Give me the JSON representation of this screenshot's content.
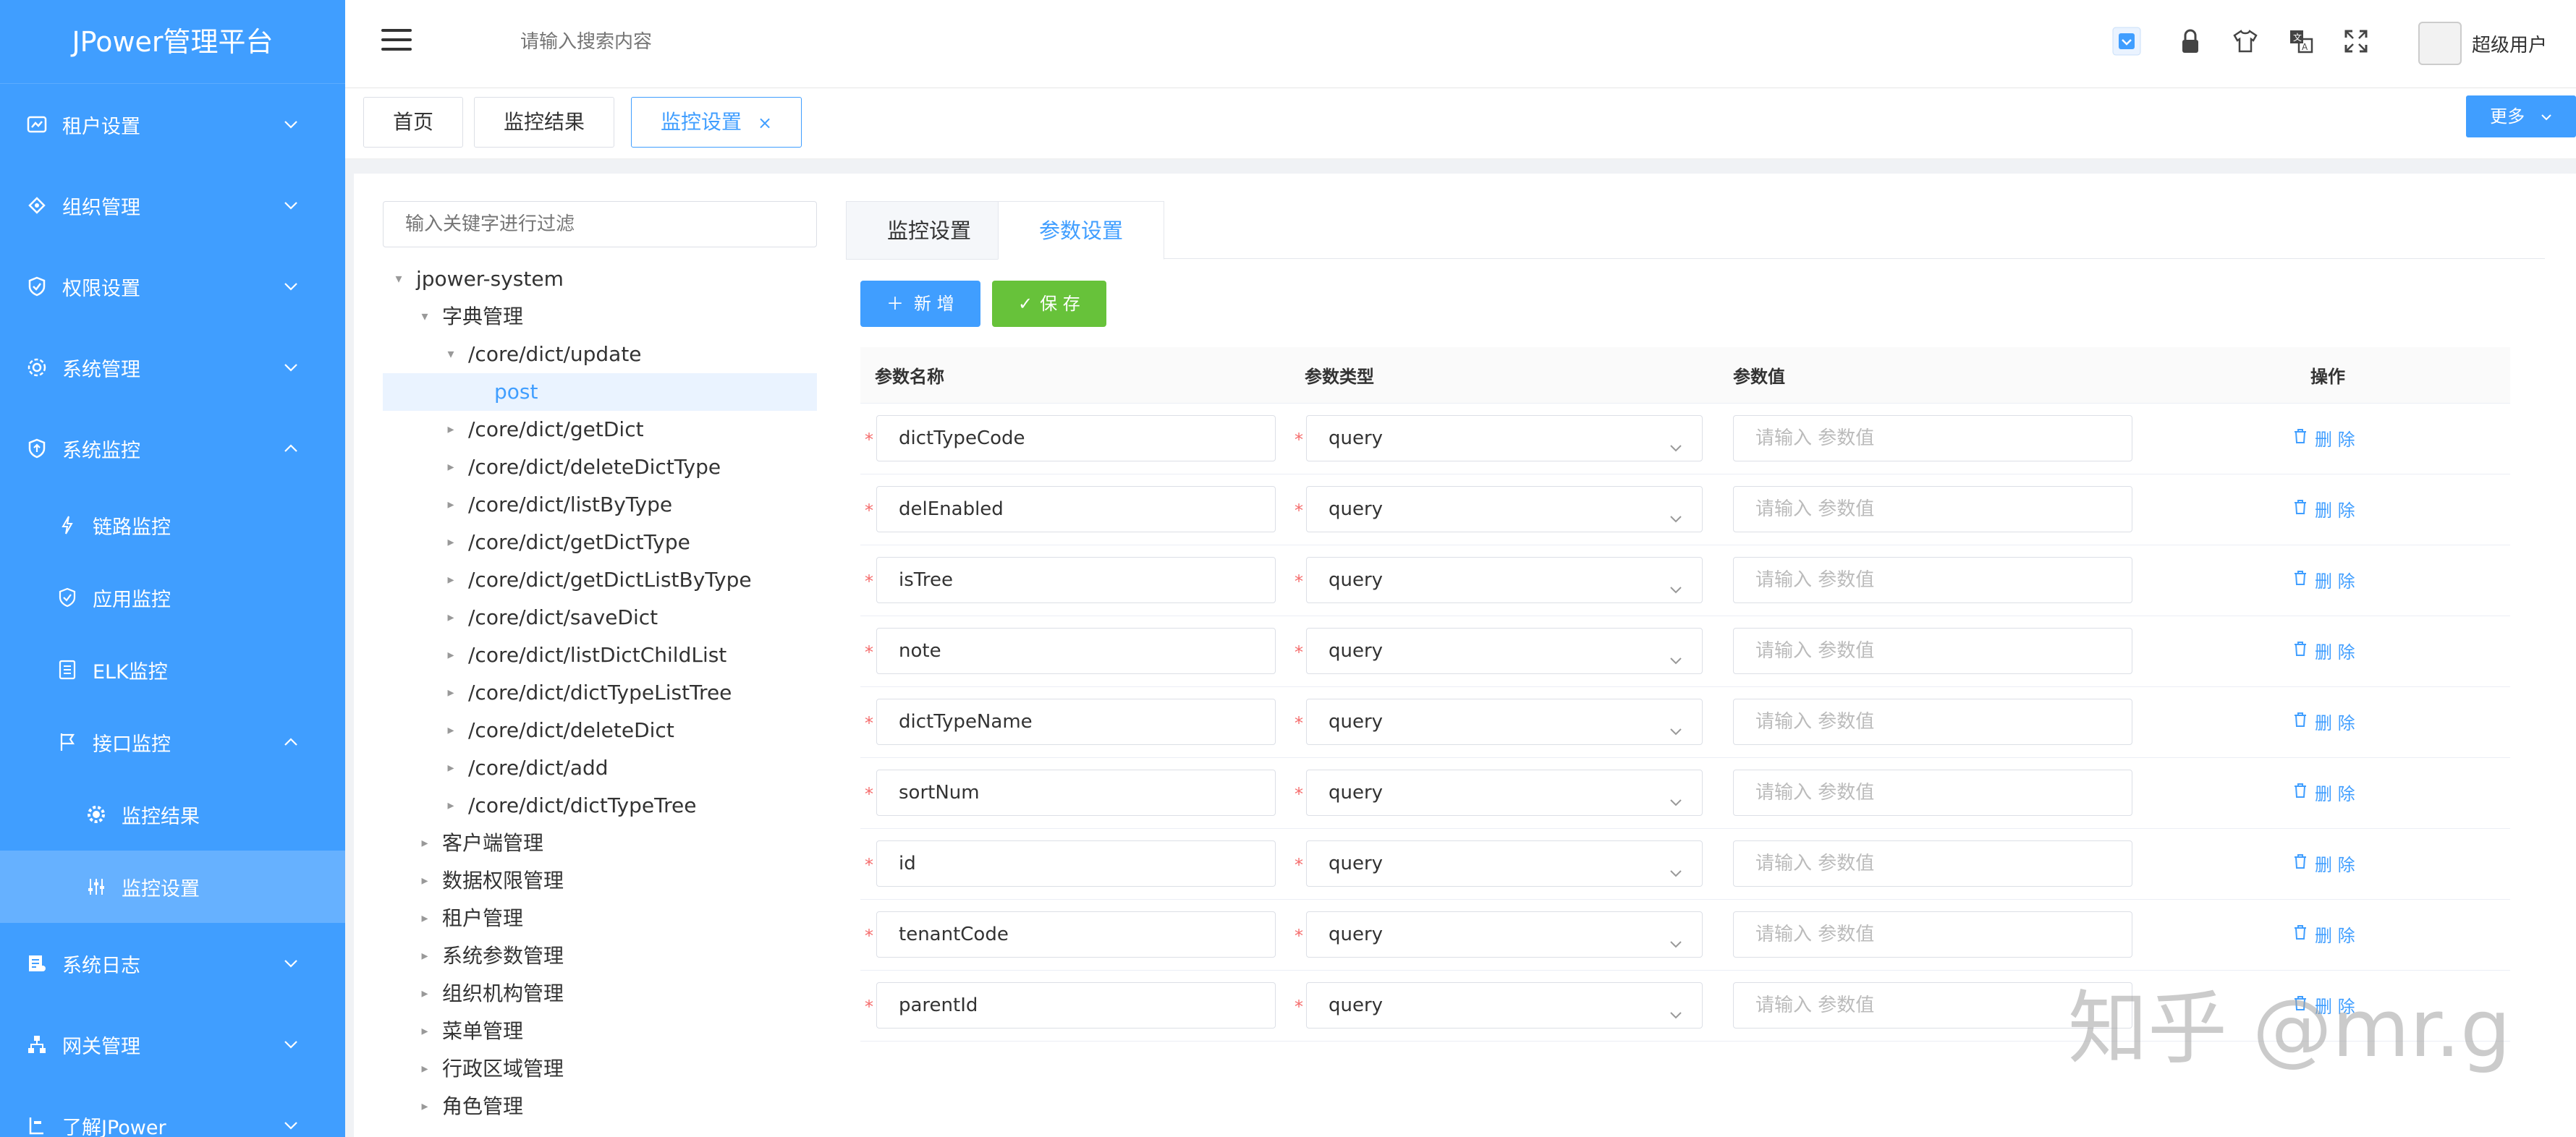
{
  "sidebar": {
    "brand": "JPower管理平台",
    "items": [
      {
        "label": "租户设置",
        "icon": "tenant-icon"
      },
      {
        "label": "组织管理",
        "icon": "org-icon"
      },
      {
        "label": "权限设置",
        "icon": "shield-icon"
      },
      {
        "label": "系统管理",
        "icon": "gear-icon"
      },
      {
        "label": "系统监控",
        "icon": "monitor-icon"
      },
      {
        "label": "链路监控",
        "icon": "lightning-icon"
      },
      {
        "label": "应用监控",
        "icon": "shield-icon"
      },
      {
        "label": "ELK监控",
        "icon": "document-icon"
      },
      {
        "label": "接口监控",
        "icon": "flag-icon"
      },
      {
        "label": "监控结果",
        "icon": "gear-icon"
      },
      {
        "label": "监控设置",
        "icon": "sliders-icon"
      },
      {
        "label": "系统日志",
        "icon": "log-icon"
      },
      {
        "label": "网关管理",
        "icon": "network-icon"
      },
      {
        "label": "了解JPower",
        "icon": "info-icon"
      }
    ]
  },
  "header": {
    "search_placeholder": "请输入搜索内容",
    "username": "超级用户"
  },
  "tagbar": {
    "tags": [
      "首页",
      "监控结果",
      "监控设置"
    ],
    "close_symbol": "×",
    "more": "更多"
  },
  "tree": {
    "filter_placeholder": "输入关键字进行过滤",
    "nodes": [
      {
        "label": "jpower-system"
      },
      {
        "label": "字典管理"
      },
      {
        "label": "/core/dict/update"
      },
      {
        "label": "post"
      },
      {
        "label": "/core/dict/getDict"
      },
      {
        "label": "/core/dict/deleteDictType"
      },
      {
        "label": "/core/dict/listByType"
      },
      {
        "label": "/core/dict/getDictType"
      },
      {
        "label": "/core/dict/getDictListByType"
      },
      {
        "label": "/core/dict/saveDict"
      },
      {
        "label": "/core/dict/listDictChildList"
      },
      {
        "label": "/core/dict/dictTypeListTree"
      },
      {
        "label": "/core/dict/deleteDict"
      },
      {
        "label": "/core/dict/add"
      },
      {
        "label": "/core/dict/dictTypeTree"
      },
      {
        "label": "客户端管理"
      },
      {
        "label": "数据权限管理"
      },
      {
        "label": "租户管理"
      },
      {
        "label": "系统参数管理"
      },
      {
        "label": "组织机构管理"
      },
      {
        "label": "菜单管理"
      },
      {
        "label": "行政区域管理"
      },
      {
        "label": "角色管理"
      }
    ]
  },
  "form": {
    "tabs": [
      "监控设置",
      "参数设置"
    ],
    "add_label": "新 增",
    "save_label": "保 存",
    "columns": [
      "参数名称",
      "参数类型",
      "参数值",
      "操作"
    ],
    "value_placeholder": "请输入 参数值",
    "delete_label": "删 除",
    "required_mark": "*",
    "rows": [
      {
        "name": "dictTypeCode",
        "type": "query"
      },
      {
        "name": "delEnabled",
        "type": "query"
      },
      {
        "name": "isTree",
        "type": "query"
      },
      {
        "name": "note",
        "type": "query"
      },
      {
        "name": "dictTypeName",
        "type": "query"
      },
      {
        "name": "sortNum",
        "type": "query"
      },
      {
        "name": "id",
        "type": "query"
      },
      {
        "name": "tenantCode",
        "type": "query"
      },
      {
        "name": "parentId",
        "type": "query"
      }
    ]
  },
  "watermark": "知乎 @mr.g",
  "colors": {
    "primary": "#409EFF",
    "success": "#67C23A",
    "danger": "#F56C6C"
  }
}
